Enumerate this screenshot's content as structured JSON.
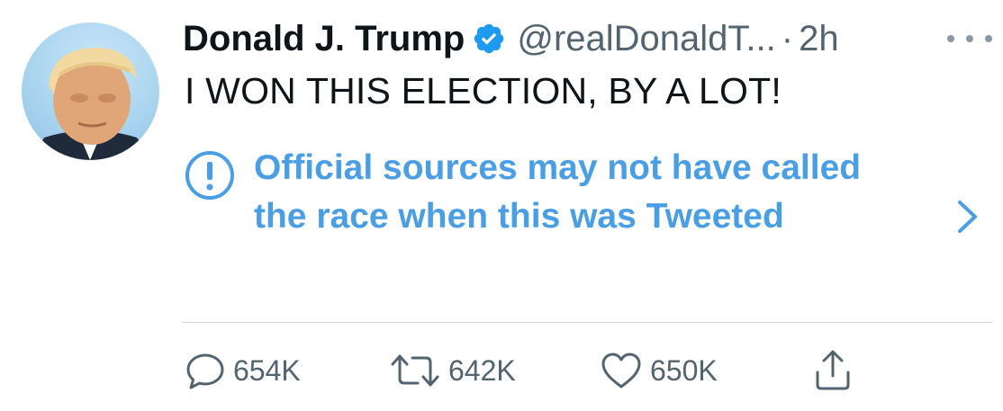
{
  "tweet": {
    "author_name": "Donald J. Trump",
    "handle": "@realDonaldT...",
    "separator": "·",
    "time": "2h",
    "text": "I WON THIS ELECTION, BY A LOT!",
    "avatar_icon": "profile-photo",
    "verified_icon": "verified-badge-icon",
    "more_icon": "more-options-icon"
  },
  "notice": {
    "icon": "exclamation-circle-icon",
    "text": "Official sources may not have called the race when this was Tweeted",
    "chevron_icon": "chevron-right-icon"
  },
  "actions": {
    "reply": {
      "icon": "reply-icon",
      "count": "654K"
    },
    "retweet": {
      "icon": "retweet-icon",
      "count": "642K"
    },
    "like": {
      "icon": "heart-icon",
      "count": "650K"
    },
    "share": {
      "icon": "share-icon"
    }
  },
  "colors": {
    "text": "#0f1419",
    "secondary": "#536471",
    "accent": "#4a9fe4",
    "verified": "#1d9bf0",
    "divider": "#cfd9de"
  }
}
